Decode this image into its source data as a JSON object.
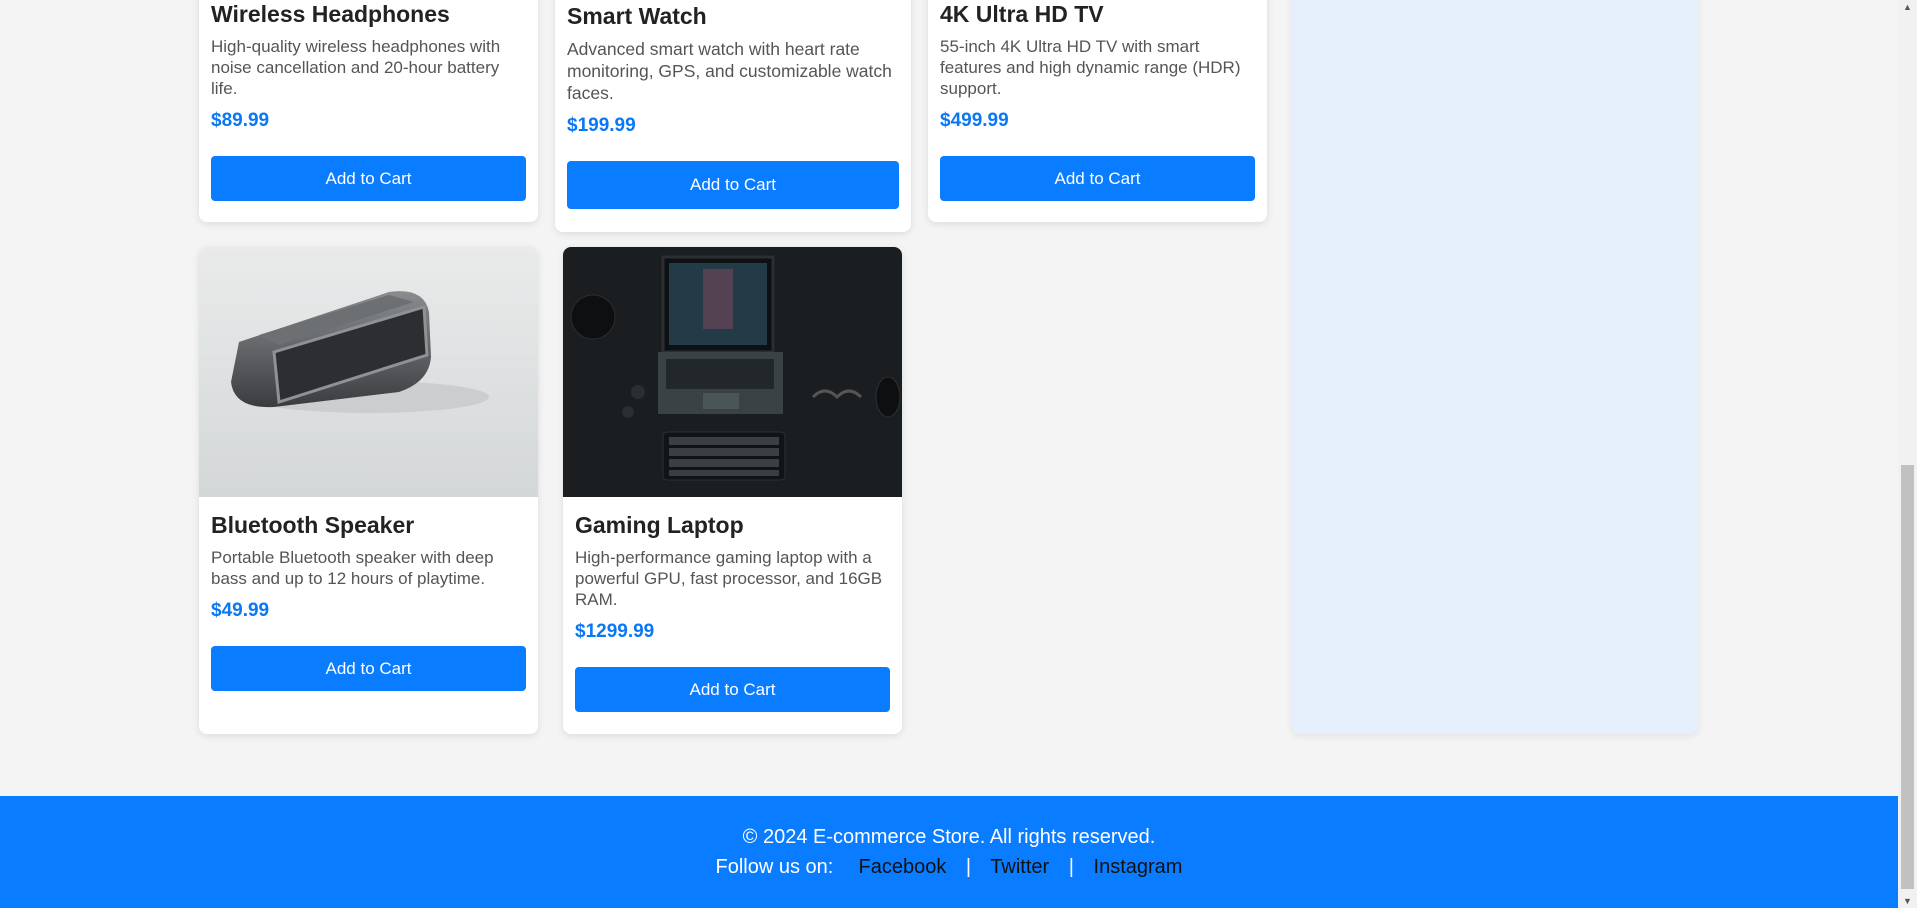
{
  "products": [
    {
      "name": "Wireless Headphones",
      "description": "High-quality wireless headphones with noise cancellation and 20-hour battery life.",
      "price": "$89.99",
      "button": "Add to Cart"
    },
    {
      "name": "Smart Watch",
      "description": "Advanced smart watch with heart rate monitoring, GPS, and customizable watch faces.",
      "price": "$199.99",
      "button": "Add to Cart"
    },
    {
      "name": "4K Ultra HD TV",
      "description": "55-inch 4K Ultra HD TV with smart features and high dynamic range (HDR) support.",
      "price": "$499.99",
      "button": "Add to Cart"
    },
    {
      "name": "Bluetooth Speaker",
      "description": "Portable Bluetooth speaker with deep bass and up to 12 hours of playtime.",
      "price": "$49.99",
      "button": "Add to Cart"
    },
    {
      "name": "Gaming Laptop",
      "description": "High-performance gaming laptop with a powerful GPU, fast processor, and 16GB RAM.",
      "price": "$1299.99",
      "button": "Add to Cart"
    }
  ],
  "footer": {
    "copyright": "© 2024 E-commerce Store. All rights reserved.",
    "follow_label": "Follow us on:",
    "links": [
      "Facebook",
      "Twitter",
      "Instagram"
    ],
    "separator": "|"
  },
  "colors": {
    "accent": "#0a7cff",
    "price": "#0a78f5",
    "sidebar": "#e6effc"
  }
}
